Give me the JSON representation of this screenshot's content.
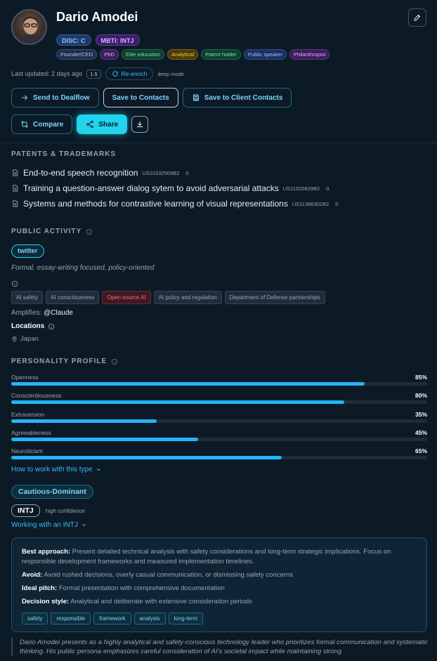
{
  "profile": {
    "name": "Dario Amodei",
    "disc": "DISC: C",
    "mbti": "MBTI: INTJ",
    "tags": [
      "Founder/CEO",
      "PhD",
      "Elite education",
      "Analytical",
      "Patent holder",
      "Public speaker",
      "Philanthropist"
    ],
    "last_updated": "Last updated: 2 days ago",
    "version": "1.5",
    "reenrich_label": "Re-enrich",
    "deep_mode": "deep mode"
  },
  "actions": {
    "send_dealflow": "Send to Dealflow",
    "save_contacts": "Save to Contacts",
    "save_client_contacts": "Save to Client Contacts",
    "compare": "Compare",
    "share": "Share"
  },
  "patents": {
    "title": "PATENTS & TRADEMARKS",
    "items": [
      {
        "title": "End-to-end speech recognition",
        "code": "US10332509B2",
        "count": "0"
      },
      {
        "title": "Training a question-answer dialog sytem to avoid adversarial attacks",
        "code": "US11520829B2",
        "count": "0"
      },
      {
        "title": "Systems and methods for contrastive learning of visual representations",
        "code": "US11386302B2",
        "count": "0"
      }
    ]
  },
  "public_activity": {
    "title": "PUBLIC ACTIVITY",
    "platform": "twitter",
    "style": "Formal, essay-writing focused, policy-oriented",
    "topics": [
      "AI safety",
      "AI consciousness",
      "Open source AI",
      "AI policy and regulation",
      "Department of Defense partnerships"
    ],
    "amplifies_label": "Amplifies:",
    "amplifies_value": "@Claude",
    "locations_label": "Locations",
    "location": "Japan"
  },
  "personality": {
    "title": "PERSONALITY PROFILE",
    "traits": [
      {
        "label": "Openness",
        "pct_label": "85%",
        "value": 85
      },
      {
        "label": "Conscientiousness",
        "pct_label": "80%",
        "value": 80
      },
      {
        "label": "Extraversion",
        "pct_label": "35%",
        "value": 35
      },
      {
        "label": "Agreeableness",
        "pct_label": "45%",
        "value": 45
      },
      {
        "label": "Neuroticism",
        "pct_label": "65%",
        "value": 65
      }
    ],
    "how_to_work": "How to work with this type",
    "disc_style": "Cautious-Dominant",
    "mbti_type": "INTJ",
    "confidence": "high confidence",
    "working_with": "Working with an INTJ"
  },
  "guide": {
    "best_label": "Best approach:",
    "best_text": "Present detailed technical analysis with safety considerations and long-term strategic implications. Focus on responsible development frameworks and measured implementation timelines.",
    "avoid_label": "Avoid:",
    "avoid_text": "Avoid rushed decisions, overly casual communication, or dismissing safety concerns",
    "pitch_label": "Ideal pitch:",
    "pitch_text": "Formal presentation with comprehensive documentation",
    "decision_label": "Decision style:",
    "decision_text": "Analytical and deliberate with extensive consideration periods",
    "keywords": [
      "safety",
      "responsible",
      "framework",
      "analysis",
      "long-term"
    ]
  },
  "summary": "Dario Amodei presents as a highly analytical and safety-conscious technology leader who prioritizes formal communication and systematic thinking. His public persona emphasizes careful consideration of AI's societal impact while maintaining strong"
}
